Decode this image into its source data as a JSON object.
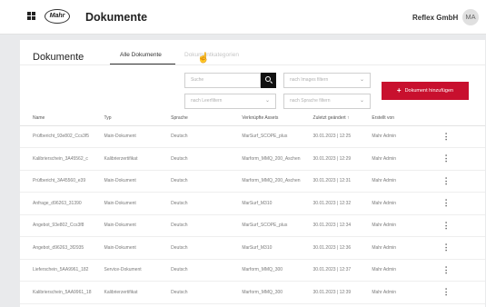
{
  "header": {
    "logo_text": "Mahr",
    "app_title": "Dokumente",
    "company": "Reflex GmbH",
    "avatar_initials": "MA"
  },
  "page": {
    "title": "Dokumente",
    "tabs": [
      {
        "label": "Alle Dokumente",
        "active": true
      },
      {
        "label": "Dokumentkategorien",
        "active": false
      }
    ]
  },
  "filters": {
    "search_placeholder": "Suche",
    "images_placeholder": "nach Images filtern",
    "location_placeholder": "nach Leerfiltern",
    "language_placeholder": "nach Sprache filtern"
  },
  "actions": {
    "add_document_label": "Dokument hinzufügen",
    "accent_color": "#c8102e"
  },
  "table": {
    "columns": [
      "Name",
      "Typ",
      "Sprache",
      "Verknüpfte Assets",
      "Zuletzt geändert",
      "Erstellt von"
    ],
    "sort_indicator": "↑",
    "rows": [
      {
        "name": "Prüfbericht_93e802_Ccs3f5",
        "type": "Main-Dokument",
        "language": "Deutsch",
        "assets": "MarSurf_SCOPE_plus",
        "modified": "30.01.2023 | 12:25",
        "author": "Mahr Admin"
      },
      {
        "name": "Kalibrierschein_3A45562_c",
        "type": "Kalibrierzertifikat",
        "language": "Deutsch",
        "assets": "Marform_MMQ_200_Aschen",
        "modified": "30.01.2023 | 12:29",
        "author": "Mahr Admin"
      },
      {
        "name": "Prüfbericht_3A45560_e39",
        "type": "Main-Dokument",
        "language": "Deutsch",
        "assets": "Marform_MMQ_200_Aschen",
        "modified": "30.01.2023 | 12:31",
        "author": "Mahr Admin"
      },
      {
        "name": "Anfrage_d96263_31390",
        "type": "Main-Dokument",
        "language": "Deutsch",
        "assets": "MarSurf_M310",
        "modified": "30.01.2023 | 12:32",
        "author": "Mahr Admin"
      },
      {
        "name": "Angebot_93e802_Ccs3f8",
        "type": "Main-Dokument",
        "language": "Deutsch",
        "assets": "MarSurf_SCOPE_plus",
        "modified": "30.01.2023 | 12:34",
        "author": "Mahr Admin"
      },
      {
        "name": "Angebot_d96263_3f2935",
        "type": "Main-Dokument",
        "language": "Deutsch",
        "assets": "MarSurf_M310",
        "modified": "30.01.2023 | 12:36",
        "author": "Mahr Admin"
      },
      {
        "name": "Lieferschein_5AA9961_182",
        "type": "Service-Dokument",
        "language": "Deutsch",
        "assets": "Marform_MMQ_300",
        "modified": "30.01.2023 | 12:37",
        "author": "Mahr Admin"
      },
      {
        "name": "Kalibrierschein_5AA9961_18",
        "type": "Kalibrierzertifikat",
        "language": "Deutsch",
        "assets": "Marform_MMQ_300",
        "modified": "30.01.2023 | 12:39",
        "author": "Mahr Admin"
      }
    ]
  }
}
